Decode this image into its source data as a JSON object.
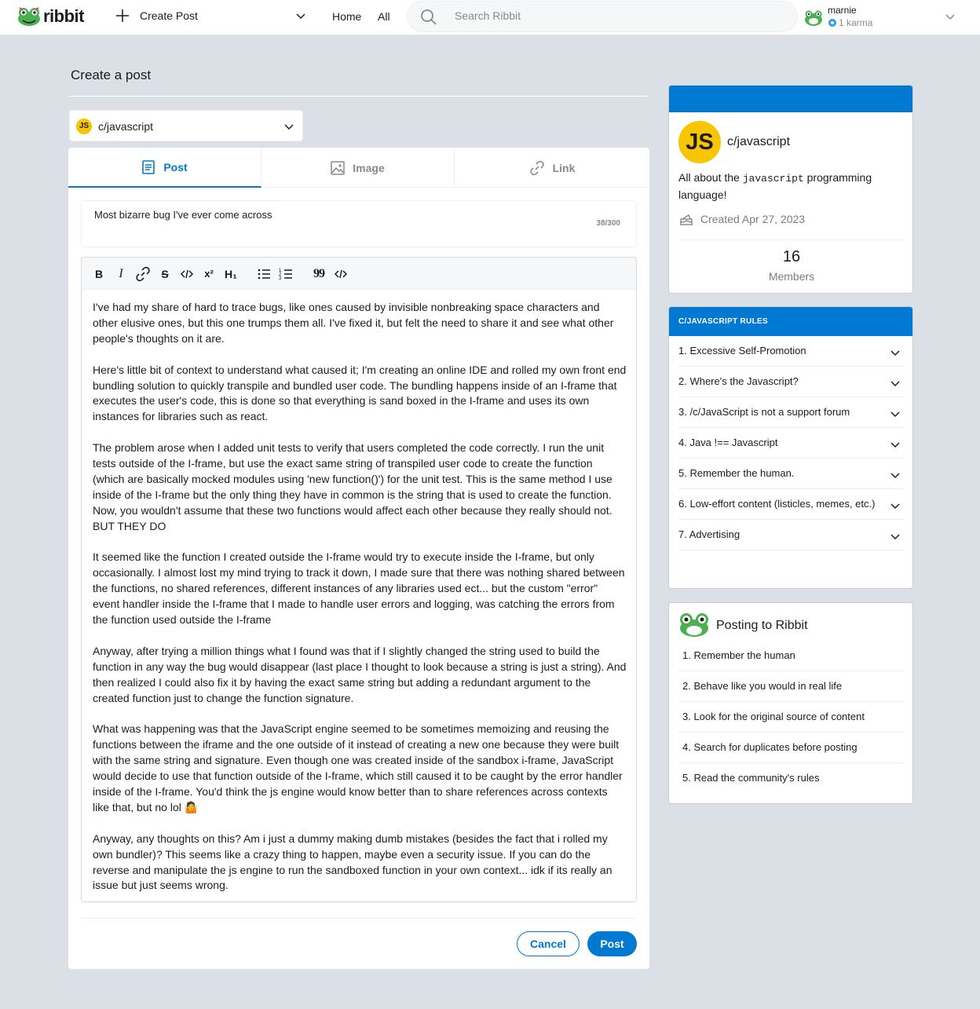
{
  "header": {
    "logo_text": "ribbit",
    "create_post_label": "Create Post",
    "nav_home": "Home",
    "nav_all": "All",
    "search_placeholder": "Search Ribbit",
    "user_name": "marnie",
    "karma": "1 karma"
  },
  "page": {
    "title": "Create a post"
  },
  "community_select": {
    "badge": "JS",
    "selected": "c/javascript"
  },
  "tabs": [
    {
      "label": "Post",
      "icon": "document-icon",
      "active": true
    },
    {
      "label": "Image",
      "icon": "image-icon",
      "active": false
    },
    {
      "label": "Link",
      "icon": "link-icon",
      "active": false
    }
  ],
  "post": {
    "title_value": "Most bizarre bug I've ever come across",
    "title_count": "38/300",
    "body_paragraphs": [
      "I've had my share of hard to trace bugs, like ones caused by invisible nonbreaking space characters and other elusive ones, but this one trumps them all. I've fixed it, but felt the need to share it and see what other people's thoughts on it are.",
      "Here's little bit of context to understand what caused it; I'm creating an online IDE and rolled my own front end bundling solution to quickly transpile and bundled user code. The bundling happens inside of an I-frame that executes the user's code, this is done so that everything is sand boxed in the I-frame and uses its own instances for libraries such as react.",
      "The problem arose when I added unit tests to verify that users completed the code correctly. I run the unit tests outside of the I-frame, but use the exact same string of transpiled user code to create the function (which are basically mocked modules using 'new function()') for the unit test. This is the same method I use inside of the I-frame but the only thing they have in common is the string that is used to create the function. Now, you wouldn't assume that these two functions would affect each other because they really should not. BUT THEY DO",
      "It seemed like the function I created outside the I-frame would try to execute inside the I-frame, but only occasionally. I almost lost my mind trying to track it down, I made sure that there was nothing shared between the functions, no shared references, different instances of any libraries used ect... but the custom \"error\" event handler inside the I-frame that I made to handle user errors and logging, was catching the errors from the function used outside the I-frame",
      "Anyway, after trying a million things what I found was that if I slightly changed the string used to build the function in any way the bug would disappear (last place I thought to look because a string is just a string). And then realized I could also fix it by having the exact same string but adding a redundant argument to the created function just to change the function signature.",
      "What was happening was that the JavaScript engine seemed to be sometimes memoizing and reusing the functions between the iframe and the one outside of it instead of creating a new one because they were built with the same string and signature. Even though one was created inside of the sandbox i-frame, JavaScript would decide to use that function outside of the I-frame, which still caused it to be caught by the error handler inside of the I-frame. You'd think the js engine would know better than to share references across contexts like that, but no lol 🤷",
      "Anyway, any thoughts on this? Am i just a dummy making dumb mistakes (besides the fact that i rolled my own bundler)? This seems like a crazy thing to happen, maybe even a security issue. If you can do the reverse and manipulate the js engine to run the sandboxed function in your own context... idk if its really an issue but just seems wrong."
    ],
    "cancel_label": "Cancel",
    "post_label": "Post"
  },
  "toolbar": {
    "bold": "B",
    "italic": "I",
    "strike": "S",
    "superscript": "x²",
    "heading": "H₁",
    "quote": "99"
  },
  "community_card": {
    "badge": "JS",
    "name": "c/javascript",
    "desc_before": "All about the ",
    "desc_code": "javascript",
    "desc_after": " programming language!",
    "created": "Created Apr 27, 2023",
    "members_count": "16",
    "members_label": "Members",
    "accent": "#0079d3"
  },
  "rules_card": {
    "heading": "C/JAVASCRIPT RULES",
    "rules": [
      "1. Excessive Self-Promotion",
      "2. Where's the Javascript?",
      "3. /c/JavaScript is not a support forum",
      "4. Java !== Javascript",
      "5. Remember the human.",
      "6. Low-effort content (listicles, memes, etc.)",
      "7. Advertising"
    ]
  },
  "posting_card": {
    "title": "Posting to Ribbit",
    "items": [
      "1. Remember the human",
      "2. Behave like you would in real life",
      "3. Look for the original source of content",
      "4. Search for duplicates before posting",
      "5. Read the community's rules"
    ]
  }
}
